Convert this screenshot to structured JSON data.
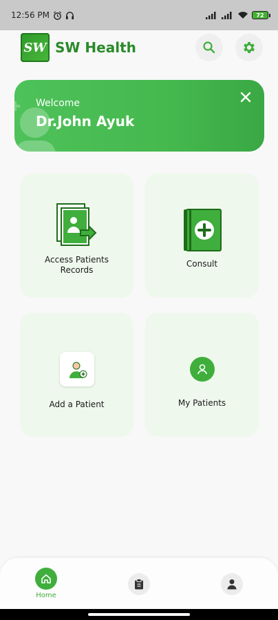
{
  "status_bar": {
    "time": "12:56 PM",
    "battery": "72"
  },
  "header": {
    "app_name": "SW Health",
    "logo_text": "SW"
  },
  "banner": {
    "welcome": "Welcome",
    "doctor_name": "Dr.John Ayuk"
  },
  "cards": [
    {
      "label_line1": "Access Patients",
      "label_line2": "Records"
    },
    {
      "label": "Consult"
    },
    {
      "label": "Add a Patient"
    },
    {
      "label": "My Patients"
    }
  ],
  "bottom_nav": {
    "home_label": "Home"
  },
  "colors": {
    "brand_green": "#3fae3c",
    "title_green": "#2a8a2a",
    "card_bg": "#eef8ec"
  }
}
